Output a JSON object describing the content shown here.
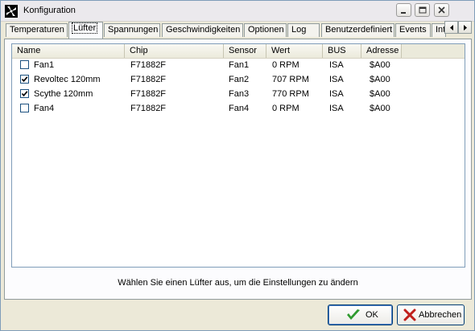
{
  "window": {
    "title": "Konfiguration"
  },
  "tabs": [
    {
      "label": "Temperaturen"
    },
    {
      "label": "Lüfter"
    },
    {
      "label": "Spannungen"
    },
    {
      "label": "Geschwindigkeiten"
    },
    {
      "label": "Optionen"
    },
    {
      "label": "Log"
    },
    {
      "label": "Benutzerdefiniert"
    },
    {
      "label": "Events"
    },
    {
      "label": "Int"
    }
  ],
  "active_tab": "Lüfter",
  "table": {
    "columns": [
      "Name",
      "Chip",
      "Sensor",
      "Wert",
      "BUS",
      "Adresse"
    ],
    "rows": [
      {
        "checked": false,
        "name": "Fan1",
        "chip": "F71882F",
        "sensor": "Fan1",
        "wert": "0 RPM",
        "bus": "ISA",
        "adresse": "$A00"
      },
      {
        "checked": true,
        "name": "Revoltec 120mm",
        "chip": "F71882F",
        "sensor": "Fan2",
        "wert": "707 RPM",
        "bus": "ISA",
        "adresse": "$A00"
      },
      {
        "checked": true,
        "name": "Scythe 120mm",
        "chip": "F71882F",
        "sensor": "Fan3",
        "wert": "770 RPM",
        "bus": "ISA",
        "adresse": "$A00"
      },
      {
        "checked": false,
        "name": "Fan4",
        "chip": "F71882F",
        "sensor": "Fan4",
        "wert": "0 RPM",
        "bus": "ISA",
        "adresse": "$A00"
      }
    ]
  },
  "hint": "Wählen Sie einen Lüfter aus, um die Einstellungen zu ändern",
  "buttons": {
    "ok": "OK",
    "cancel": "Abbrechen"
  },
  "colors": {
    "ok_check": "#2f9a2f",
    "cancel_x": "#c0201c",
    "selection_border": "#003c74"
  },
  "icons": {
    "app": "fan-logo-icon",
    "minimize": "minimize-icon",
    "maximize": "maximize-icon",
    "close": "close-icon"
  }
}
